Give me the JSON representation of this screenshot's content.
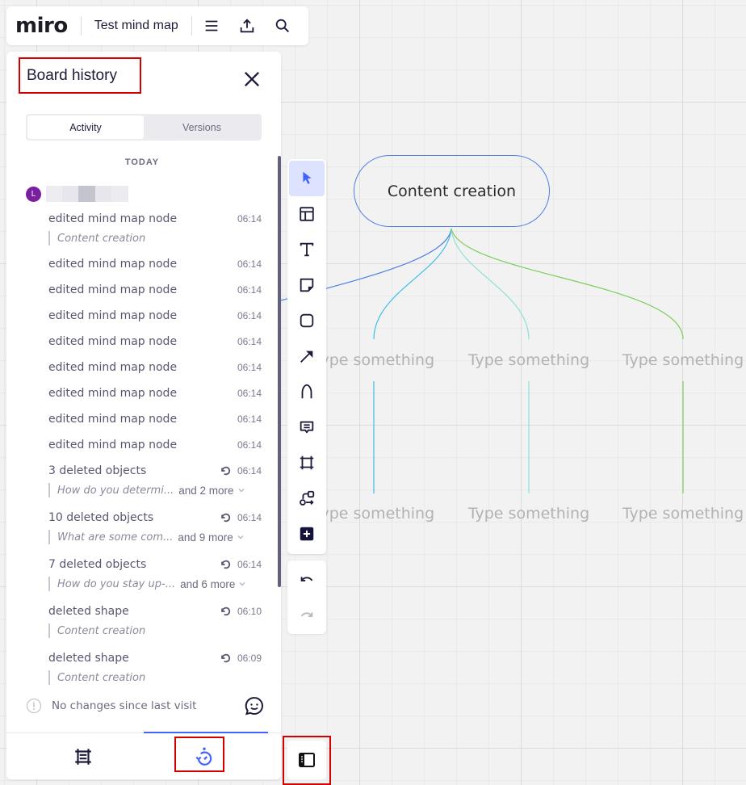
{
  "topbar": {
    "logo": "miro",
    "board_name": "Test mind map",
    "icons": [
      "menu-icon",
      "export-icon",
      "search-icon"
    ]
  },
  "panel": {
    "title": "Board history",
    "tabs": [
      {
        "label": "Activity",
        "active": true
      },
      {
        "label": "Versions",
        "active": false
      }
    ],
    "date_header": "TODAY",
    "user": {
      "initial": "L"
    },
    "entries": [
      {
        "title": "edited mind map node",
        "time": "06:14",
        "detail": "Content creation",
        "restorable": false
      },
      {
        "title": "edited mind map node",
        "time": "06:14",
        "restorable": false
      },
      {
        "title": "edited mind map node",
        "time": "06:14",
        "restorable": false
      },
      {
        "title": "edited mind map node",
        "time": "06:14",
        "restorable": false
      },
      {
        "title": "edited mind map node",
        "time": "06:14",
        "restorable": false
      },
      {
        "title": "edited mind map node",
        "time": "06:14",
        "restorable": false
      },
      {
        "title": "edited mind map node",
        "time": "06:14",
        "restorable": false
      },
      {
        "title": "edited mind map node",
        "time": "06:14",
        "restorable": false
      },
      {
        "title": "edited mind map node",
        "time": "06:14",
        "restorable": false
      },
      {
        "title": "3 deleted objects",
        "time": "06:14",
        "detail": "How do you determi...",
        "more": "and 2 more",
        "restorable": true
      },
      {
        "title": "10 deleted objects",
        "time": "06:14",
        "detail": "What are some com...",
        "more": "and 9 more",
        "restorable": true
      },
      {
        "title": "7 deleted objects",
        "time": "06:14",
        "detail": "How do you stay up-...",
        "more": "and 6 more",
        "restorable": true
      },
      {
        "title": "deleted shape",
        "time": "06:10",
        "detail": "Content creation",
        "restorable": true
      },
      {
        "title": "deleted shape",
        "time": "06:09",
        "detail": "Content creation",
        "restorable": true
      }
    ],
    "footer_note": "No changes since last visit",
    "bottom_tabs": [
      {
        "name": "frames",
        "icon": "frame-icon",
        "active": false
      },
      {
        "name": "history",
        "icon": "history-icon",
        "active": true
      }
    ]
  },
  "toolbar": {
    "tools": [
      {
        "name": "select",
        "icon": "cursor-icon",
        "active": true
      },
      {
        "name": "templates",
        "icon": "template-icon"
      },
      {
        "name": "text",
        "icon": "text-icon"
      },
      {
        "name": "sticky-note",
        "icon": "sticky-note-icon"
      },
      {
        "name": "shape",
        "icon": "shape-icon"
      },
      {
        "name": "connection-line",
        "icon": "arrow-icon"
      },
      {
        "name": "pen",
        "icon": "pen-icon"
      },
      {
        "name": "comment",
        "icon": "comment-icon"
      },
      {
        "name": "frame",
        "icon": "frame-icon"
      },
      {
        "name": "mind-map",
        "icon": "mindmap-icon"
      },
      {
        "name": "more-apps",
        "icon": "plus-icon"
      }
    ],
    "undo_icon": "undo-icon",
    "redo_icon": "redo-icon",
    "redo_enabled": false
  },
  "canvas": {
    "root_node": "Content creation",
    "child_nodes": [
      "Type something",
      "Type something",
      "Type something",
      "Type something",
      "Type something",
      "Type something"
    ],
    "colors": {
      "root_border": "#4f7fe0",
      "branch_1": "#4f7fe0",
      "branch_2": "#3fbfe6",
      "branch_3": "#8fe0d6",
      "branch_4": "#7ccf5a"
    }
  },
  "colors": {
    "accent": "#4262ff",
    "highlight_box": "#d40000",
    "text_primary": "#1c1c3a",
    "text_muted": "#6b6b80",
    "avatar": "#7a1fa2"
  }
}
